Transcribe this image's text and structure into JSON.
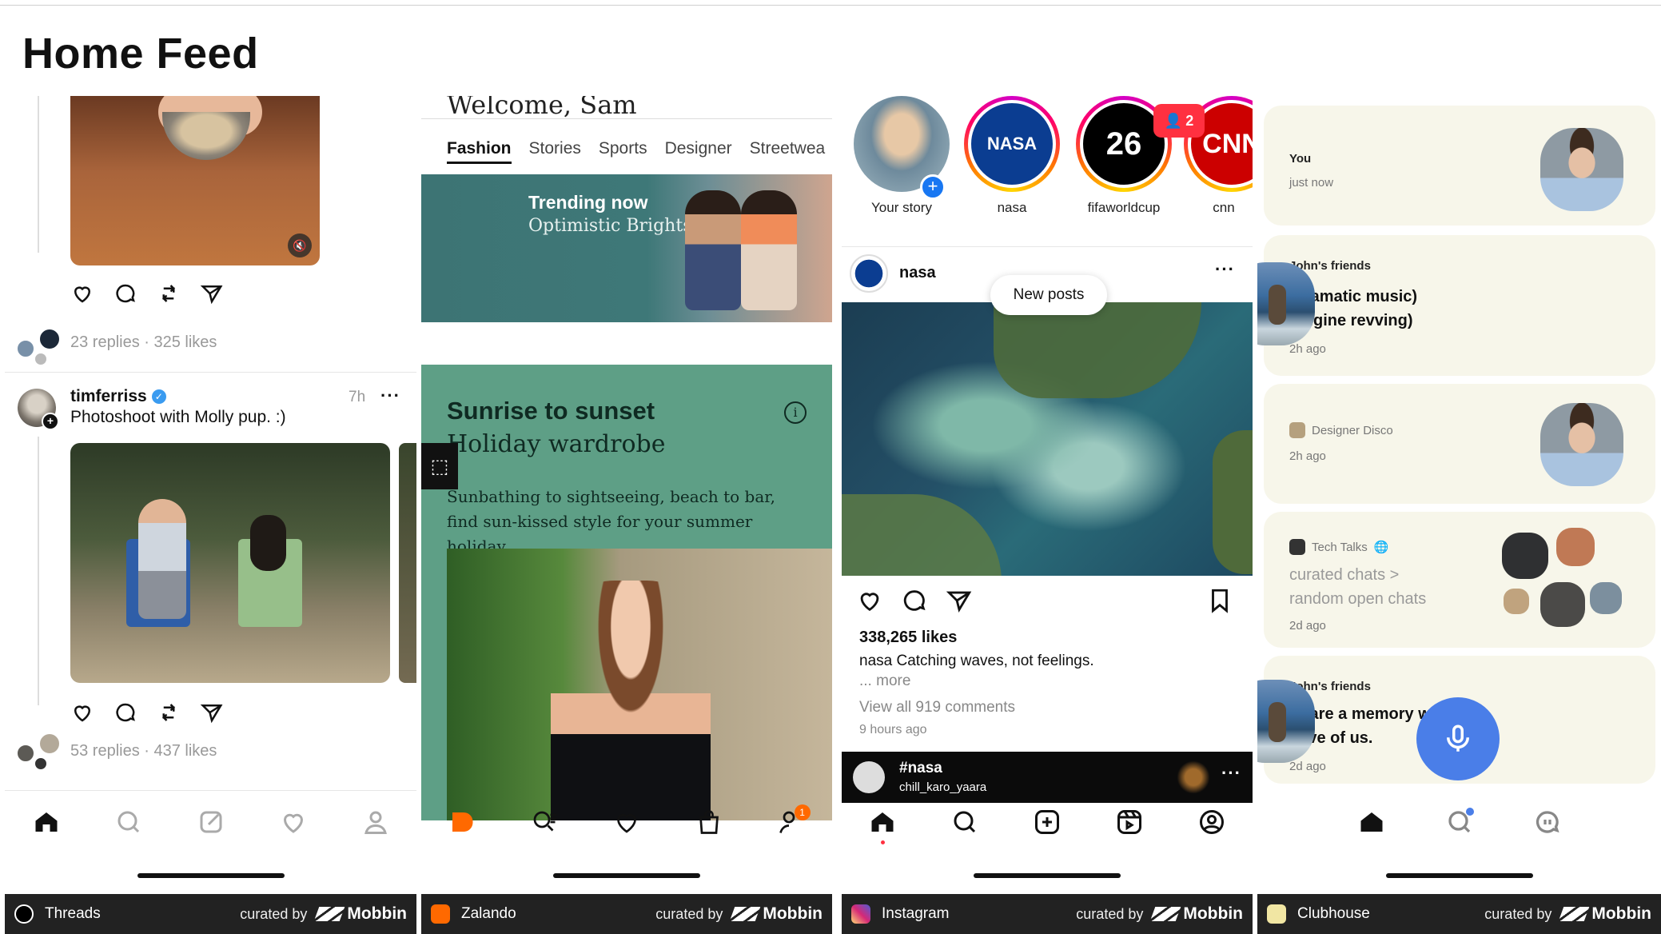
{
  "page": {
    "title": "Home Feed"
  },
  "footer": {
    "curated_label": "curated by",
    "brand": "Mobbin"
  },
  "threads": {
    "app_name": "Threads",
    "post1": {
      "replies_likes": "23 replies · 325 likes"
    },
    "post2": {
      "username": "timferriss",
      "time": "7h",
      "text": "Photoshoot with Molly pup. :)",
      "replies_likes": "53 replies · 437 likes"
    },
    "tabs": [
      "home-icon",
      "search-icon",
      "compose-icon",
      "heart-icon",
      "profile-icon"
    ]
  },
  "zalando": {
    "app_name": "Zalando",
    "welcome": "Welcome, Sam",
    "tabs": [
      "Fashion",
      "Stories",
      "Sports",
      "Designer",
      "Streetwea"
    ],
    "active_tab": "Fashion",
    "banner": {
      "title": "Trending now",
      "subtitle": "Optimistic Brights"
    },
    "card": {
      "title": "Sunrise to sunset",
      "subtitle": "Holiday wardrobe",
      "description": "Sunbathing to sightseeing, beach to bar, find sun-kissed style for your summer holiday."
    },
    "profile_badge": "1"
  },
  "instagram": {
    "app_name": "Instagram",
    "stories": [
      {
        "label": "Your story"
      },
      {
        "label": "nasa"
      },
      {
        "label": "fifaworldcup"
      },
      {
        "label": "cnn"
      }
    ],
    "follow_requests": "2",
    "post": {
      "username": "nasa",
      "new_posts": "New posts",
      "likes": "338,265 likes",
      "caption_user": "nasa",
      "caption": "Catching waves, not feelings.",
      "more": "... more",
      "comments": "View all 919 comments",
      "time": "9 hours ago"
    },
    "reel": {
      "tag": "#nasa",
      "user": "chill_karo_yaara"
    }
  },
  "clubhouse": {
    "app_name": "Clubhouse",
    "cards": [
      {
        "kicker": "You",
        "time": "just now"
      },
      {
        "kicker": "John's friends",
        "title": "(dramatic music)\n(engine revving)",
        "time": "2h ago"
      },
      {
        "source": "Designer Disco",
        "time": "2h ago"
      },
      {
        "source": "Tech Talks",
        "title": "curated chats >\nrandom open chats",
        "time": "2d ago"
      },
      {
        "kicker": "John's friends",
        "title": "Share a memory w\nhave of us.",
        "time": "2d ago"
      }
    ]
  }
}
